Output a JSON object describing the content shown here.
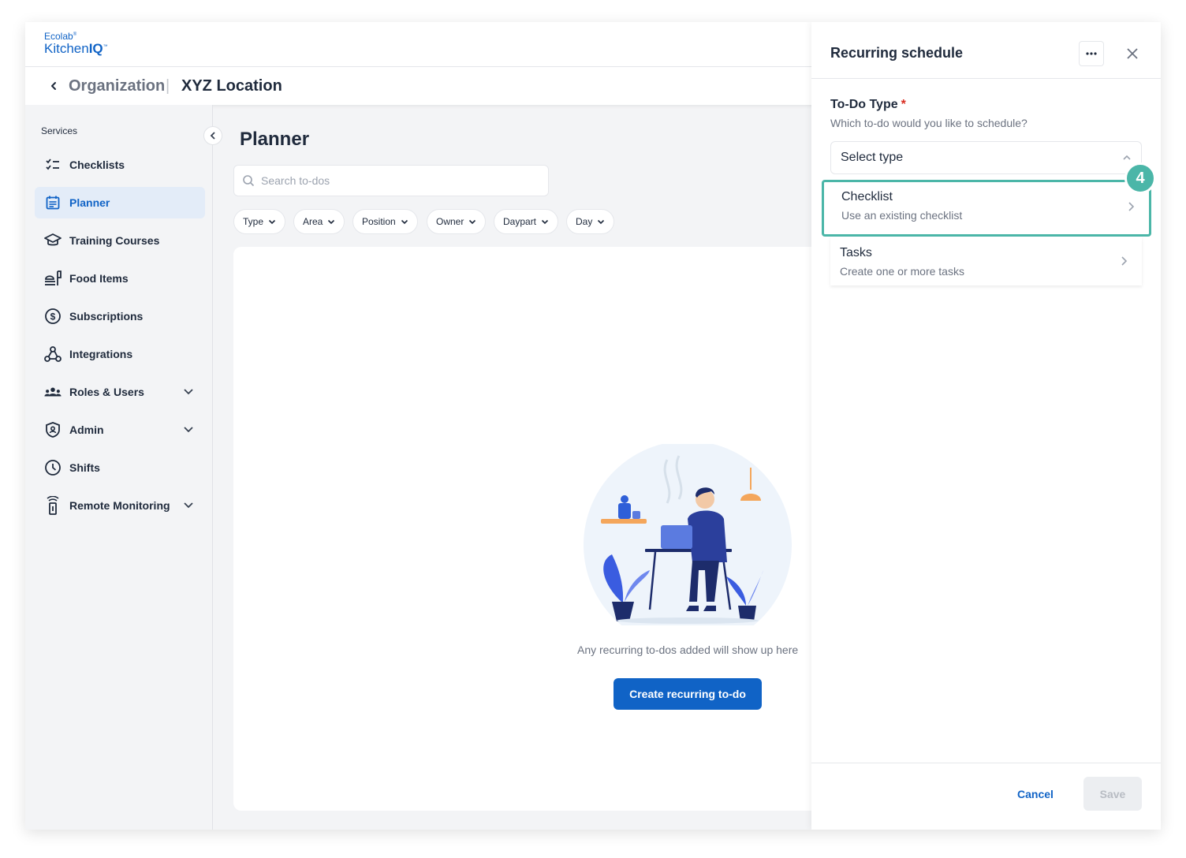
{
  "header": {
    "logo_line1": "Ecolab",
    "logo_line2_a": "Kitchen",
    "logo_line2_b": "IQ"
  },
  "breadcrumb": {
    "organization": "Organization",
    "separator": "|",
    "location": "XYZ Location"
  },
  "sidebar": {
    "section_label": "Services",
    "items": [
      {
        "label": "Checklists",
        "icon": "checklist-icon"
      },
      {
        "label": "Planner",
        "icon": "calendar-icon",
        "active": true
      },
      {
        "label": "Training Courses",
        "icon": "graduation-cap-icon"
      },
      {
        "label": "Food Items",
        "icon": "food-items-icon"
      },
      {
        "label": "Subscriptions",
        "icon": "dollar-circle-icon"
      },
      {
        "label": "Integrations",
        "icon": "webhook-icon"
      },
      {
        "label": "Roles & Users",
        "icon": "users-icon",
        "expandable": true
      },
      {
        "label": "Admin",
        "icon": "shield-icon",
        "expandable": true
      },
      {
        "label": "Shifts",
        "icon": "clock-icon"
      },
      {
        "label": "Remote Monitoring",
        "icon": "sensor-icon",
        "expandable": true
      }
    ]
  },
  "main": {
    "title": "Planner",
    "search_placeholder": "Search to-dos",
    "filters": [
      "Type",
      "Area",
      "Position",
      "Owner",
      "Daypart",
      "Day"
    ],
    "empty_text": "Any recurring to-dos added will show up here",
    "create_button": "Create recurring to-do"
  },
  "drawer": {
    "title": "Recurring schedule",
    "field_label": "To-Do Type",
    "required_mark": "*",
    "field_help": "Which to-do would you like to schedule?",
    "select_placeholder": "Select type",
    "options": [
      {
        "title": "Checklist",
        "subtitle": "Use an existing checklist"
      },
      {
        "title": "Tasks",
        "subtitle": "Create one or more tasks"
      }
    ],
    "step_badge": "4",
    "cancel": "Cancel",
    "save": "Save"
  },
  "colors": {
    "brand_blue": "#1063c6",
    "highlight_teal": "#4bb6a8",
    "required_red": "#d92d20"
  }
}
